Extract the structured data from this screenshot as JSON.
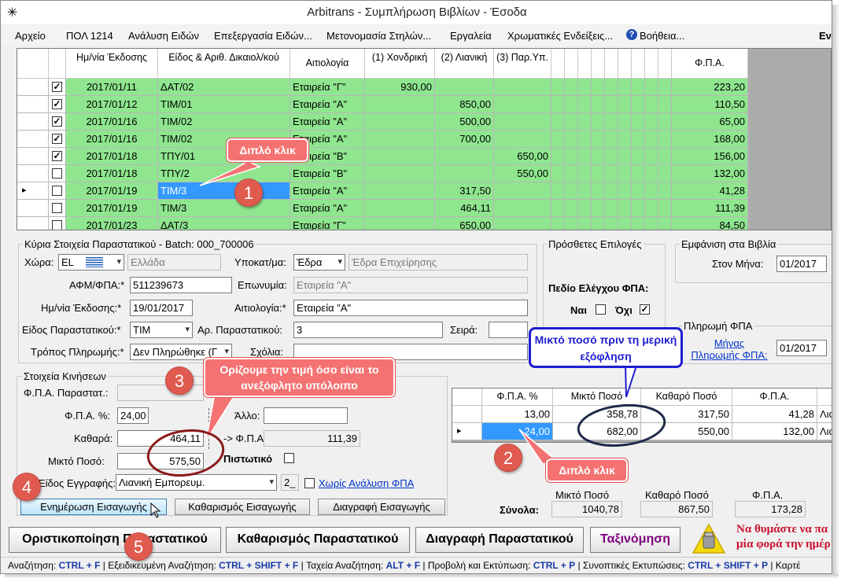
{
  "window": {
    "title": "Arbitrans - Συμπλήρωση Βιβλίων - Έσοδα"
  },
  "menu": [
    {
      "label": "Αρχείο"
    },
    {
      "label": "ΠΟΛ 1214"
    },
    {
      "label": "Ανάλυση Ειδών"
    },
    {
      "label": "Επεξεργασία Ειδών..."
    },
    {
      "label": "Μετονομασία Στηλών..."
    },
    {
      "label": "Εργαλεία"
    },
    {
      "label": "Χρωματικές Ενδείξεις..."
    },
    {
      "label": "Βοήθεια..."
    },
    {
      "label": "Εντο"
    }
  ],
  "grid": {
    "headers": {
      "date": "Ημ/νία Έκδοσης",
      "doc": "Είδος & Αριθ. Δικαιολ/κού",
      "reason": "Αιτιολογία",
      "c1": "(1) Χονδρική",
      "c2": "(2) Λιανική",
      "c3": "(3) Παρ.Υπ.",
      "vat": "Φ.Π.Α."
    },
    "rows": [
      {
        "checked": true,
        "date": "2017/01/11",
        "doc": "ΔΑΤ/02",
        "reason": "Εταιρεία \"Γ\"",
        "c1": "930,00",
        "c2": "",
        "c3": "",
        "vat": "223,20"
      },
      {
        "checked": true,
        "date": "2017/01/12",
        "doc": "ΤΙΜ/01",
        "reason": "Εταιρεία \"Α\"",
        "c1": "",
        "c2": "850,00",
        "c3": "",
        "vat": "110,50"
      },
      {
        "checked": true,
        "date": "2017/01/16",
        "doc": "ΤΙΜ/02",
        "reason": "Εταιρεία \"Α\"",
        "c1": "",
        "c2": "500,00",
        "c3": "",
        "vat": "65,00"
      },
      {
        "checked": true,
        "date": "2017/01/16",
        "doc": "ΤΙΜ/02",
        "reason": "Εταιρεία \"Α\"",
        "c1": "",
        "c2": "700,00",
        "c3": "",
        "vat": "168,00"
      },
      {
        "checked": true,
        "date": "2017/01/18",
        "doc": "ΤΠΥ/01",
        "reason": "Εταιρεία \"Β\"",
        "c1": "",
        "c2": "",
        "c3": "650,00",
        "vat": "156,00"
      },
      {
        "checked": false,
        "date": "2017/01/18",
        "doc": "ΤΠΥ/2",
        "reason": "Εταιρεία \"Β\"",
        "c1": "",
        "c2": "",
        "c3": "550,00",
        "vat": "132,00"
      },
      {
        "checked": false,
        "date": "2017/01/19",
        "doc": "ΤΙΜ/3",
        "reason": "Εταιρεία \"Α\"",
        "c1": "",
        "c2": "317,50",
        "c3": "",
        "vat": "41,28"
      },
      {
        "checked": false,
        "date": "2017/01/19",
        "doc": "ΤΙΜ/3",
        "reason": "Εταιρεία \"Α\"",
        "c1": "",
        "c2": "464,11",
        "c3": "",
        "vat": "111,39"
      },
      {
        "checked": false,
        "date": "2017/01/23",
        "doc": "ΔΑΤ/3",
        "reason": "Εταιρεία \"Γ\"",
        "c1": "",
        "c2": "650,00",
        "c3": "",
        "vat": "84,50"
      }
    ]
  },
  "main": {
    "group_title": "Κύρια Στοιχεία Παραστατικού - Batch: 000_700006",
    "country_label": "Χώρα:",
    "country_code": "EL",
    "country_name": "Ελλάδα",
    "branch_label": "Υποκατ/μα:",
    "branch_code": "Έδρα",
    "branch_name": "Έδρα Επιχείρησης",
    "afm_label": "ΑΦΜ/ΦΠΑ:*",
    "afm_value": "511239673",
    "name_label": "Επωνυμία:",
    "name_value": "Εταιρεία \"Α\"",
    "date_label": "Ημ/νία Έκδοσης:*",
    "date_value": "19/01/2017",
    "reason_label": "Αιτιολογία:*",
    "reason_value": "Εταιρεία \"Α\"",
    "doctype_label": "Είδος Παραστατικού:*",
    "doctype_value": "ΤΙΜ",
    "docnum_label": "Αρ. Παραστατικού:",
    "docnum_value": "3",
    "series_label": "Σειρά:",
    "payment_label": "Τρόπος Πληρωμής:*",
    "payment_value": "Δεν Πληρώθηκε (Γ",
    "notes_label": "Σχόλια:"
  },
  "extra": {
    "group_title": "Πρόσθετες Επιλογές",
    "vat_check_label": "Πεδίο Ελέγχου ΦΠΑ:",
    "yes_label": "Ναι",
    "yes_checked": false,
    "no_label": "Όχι",
    "no_checked": true
  },
  "books": {
    "group_title": "Εμφάνιση στα Βιβλία",
    "month_label": "Στον Μήνα:",
    "month_value": "01/2017",
    "pay_group_title": "Πληρωμή ΦΠΑ",
    "pay_month_link": "Μήνας Πληρωμής ΦΠΑ:",
    "pay_month_value": "01/2017"
  },
  "movements": {
    "group_title": "Στοιχεία Κινήσεων",
    "vat_doc_label": "Φ.Π.Α. Παραστατ.:",
    "vat_pct_label": "Φ.Π.Α. %:",
    "vat_pct_value": "24,00",
    "net_label": "Καθαρά:",
    "net_value": "464,11",
    "gross_label": "Μικτό Ποσό:",
    "gross_value": "575,50",
    "other_label": "Άλλο:",
    "vat_amount_label": "-> Φ.Π.Α.:",
    "vat_amount_value": "111,39",
    "credit_label": "Πιστωτικό",
    "entry_type_label": "Είδος Εγγραφής:",
    "entry_type_value": "Λιανική Εμπορευμ.",
    "entry_type_num": "2_",
    "no_analysis_label": "Χωρίς Ανάλυση ΦΠΑ"
  },
  "buttons": {
    "update": "Ενημέρωση Εισαγωγής",
    "clear": "Καθαρισμός Εισαγωγής",
    "delete": "Διαγραφή Εισαγωγής",
    "finalize": "Οριστικοποίηση Παραστατικού",
    "clear_doc": "Καθαρισμός Παραστατικού",
    "delete_doc": "Διαγραφή Παραστατικού",
    "sort": "Ταξινόμηση"
  },
  "vat_grid": {
    "headers": {
      "pct": "Φ.Π.Α. %",
      "gross": "Μικτό Ποσό",
      "net": "Καθαρό Ποσό",
      "vat": "Φ.Π.Α."
    },
    "rows": [
      {
        "pct": "13,00",
        "gross": "358,78",
        "net": "317,50",
        "vat": "41,28",
        "tail": "Λια"
      },
      {
        "pct": "24,00",
        "gross": "682,00",
        "net": "550,00",
        "vat": "132,00",
        "tail": "Λια"
      }
    ]
  },
  "totals": {
    "label": "Σύνολα:",
    "gross_label": "Μικτό Ποσό",
    "gross": "1040,78",
    "net_label": "Καθαρό Ποσό",
    "net": "867,50",
    "vat_label": "Φ.Π.Α.",
    "vat": "173,28"
  },
  "warning": {
    "line1": "Να θυμάστε να πα",
    "line2": "μία φορά την ημέρ"
  },
  "annotations": {
    "double_click_1": "Διπλό κλικ",
    "double_click_2": "Διπλό κλικ",
    "set_value": "Ορίζουμε την τιμή όσο είναι το ανεξόφλητο υπόλοιπο",
    "mixed_before": "Μικτό ποσό πριν τη μερική εξόφληση",
    "n1": "1",
    "n2": "2",
    "n3": "3",
    "n4": "4",
    "n5": "5"
  },
  "statusbar": [
    {
      "label": "Αναζήτηση:",
      "key": "CTRL + F"
    },
    {
      "label": "Εξειδικευμένη Αναζήτηση:",
      "key": "CTRL + SHIFT + F"
    },
    {
      "label": "Ταχεία Αναζήτηση:",
      "key": "ALT + F"
    },
    {
      "label": "Προβολή και Εκτύπωση:",
      "key": "CTRL + P"
    },
    {
      "label": "Συνοπτικές Εκτυπώσεις:",
      "key": "CTRL + SHIFT + P"
    },
    {
      "label": "Καρτέ",
      "key": ""
    }
  ],
  "colors": {
    "row_green": "#8fe68f",
    "selected_blue": "#3399ff",
    "callout_red": "#f57272",
    "info_blue": "#1e1ed2"
  }
}
